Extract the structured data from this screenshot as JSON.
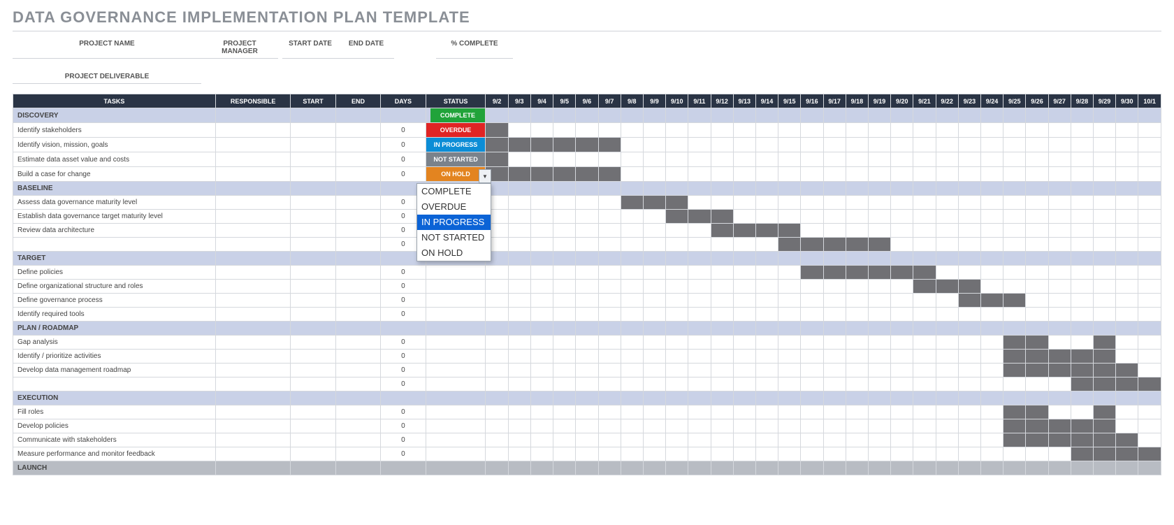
{
  "title": "DATA GOVERNANCE IMPLEMENTATION PLAN TEMPLATE",
  "meta": {
    "project_name": "PROJECT NAME",
    "project_manager": "PROJECT MANAGER",
    "start_date": "START DATE",
    "end_date": "END DATE",
    "pct_complete": "% COMPLETE",
    "project_deliverable": "PROJECT DELIVERABLE"
  },
  "columns": {
    "tasks": "TASKS",
    "responsible": "RESPONSIBLE",
    "start": "START",
    "end": "END",
    "days": "DAYS",
    "status": "STATUS"
  },
  "dates": [
    "9/2",
    "9/3",
    "9/4",
    "9/5",
    "9/6",
    "9/7",
    "9/8",
    "9/9",
    "9/10",
    "9/11",
    "9/12",
    "9/13",
    "9/14",
    "9/15",
    "9/16",
    "9/17",
    "9/18",
    "9/19",
    "9/20",
    "9/21",
    "9/22",
    "9/23",
    "9/24",
    "9/25",
    "9/26",
    "9/27",
    "9/28",
    "9/29",
    "9/30",
    "10/1"
  ],
  "status_labels": {
    "complete": "COMPLETE",
    "overdue": "OVERDUE",
    "in_progress": "IN PROGRESS",
    "not_started": "NOT STARTED",
    "on_hold": "ON HOLD"
  },
  "dropdown": {
    "options": [
      "COMPLETE",
      "OVERDUE",
      "IN PROGRESS",
      "NOT STARTED",
      "ON HOLD"
    ],
    "selected_index": 2
  },
  "rows": [
    {
      "type": "section",
      "label": "DISCOVERY",
      "status": "complete"
    },
    {
      "type": "task",
      "label": "Identify stakeholders",
      "days": "0",
      "status": "overdue",
      "bar": [
        0,
        1
      ]
    },
    {
      "type": "task",
      "label": "Identify vision, mission, goals",
      "days": "0",
      "status": "in_progress",
      "bar": [
        0,
        6
      ]
    },
    {
      "type": "task",
      "label": "Estimate data asset value and costs",
      "days": "0",
      "status": "not_started",
      "bar": [
        0,
        1
      ]
    },
    {
      "type": "task",
      "label": "Build a case for change",
      "days": "0",
      "status": "on_hold",
      "bar": [
        0,
        6
      ]
    },
    {
      "type": "section",
      "label": "BASELINE",
      "status": "dropdown"
    },
    {
      "type": "task",
      "label": "Assess data governance maturity level",
      "days": "0",
      "bar": [
        6,
        9
      ]
    },
    {
      "type": "task",
      "label": "Establish data governance target maturity level",
      "days": "0",
      "bar": [
        8,
        11
      ]
    },
    {
      "type": "task",
      "label": "Review data architecture",
      "days": "0",
      "bar": [
        10,
        14
      ]
    },
    {
      "type": "task",
      "label": "",
      "days": "0",
      "bar": [
        13,
        18
      ]
    },
    {
      "type": "section",
      "label": "TARGET"
    },
    {
      "type": "task",
      "label": "Define policies",
      "days": "0",
      "bar": [
        14,
        20
      ]
    },
    {
      "type": "task",
      "label": "Define organizational structure and roles",
      "days": "0",
      "bar": [
        19,
        22
      ]
    },
    {
      "type": "task",
      "label": "Define governance process",
      "days": "0",
      "bar": [
        21,
        24
      ]
    },
    {
      "type": "task",
      "label": "Identify required tools",
      "days": "0"
    },
    {
      "type": "section",
      "label": "PLAN / ROADMAP"
    },
    {
      "type": "task",
      "label": "Gap analysis",
      "days": "0",
      "bar": [
        [
          23,
          25
        ],
        [
          27,
          28
        ]
      ]
    },
    {
      "type": "task",
      "label": "Identify / prioritize activities",
      "days": "0",
      "bar": [
        23,
        28
      ]
    },
    {
      "type": "task",
      "label": "Develop data management roadmap",
      "days": "0",
      "bar": [
        23,
        29
      ]
    },
    {
      "type": "task",
      "label": "",
      "days": "0",
      "bar": [
        26,
        30
      ]
    },
    {
      "type": "section",
      "label": "EXECUTION"
    },
    {
      "type": "task",
      "label": "Fill roles",
      "days": "0",
      "bar": [
        [
          23,
          25
        ],
        [
          27,
          28
        ]
      ]
    },
    {
      "type": "task",
      "label": "Develop policies",
      "days": "0",
      "bar": [
        23,
        28
      ]
    },
    {
      "type": "task",
      "label": "Communicate with stakeholders",
      "days": "0",
      "bar": [
        23,
        29
      ]
    },
    {
      "type": "task",
      "label": "Measure performance and monitor feedback",
      "days": "0",
      "bar": [
        26,
        30
      ]
    },
    {
      "type": "launch",
      "label": "LAUNCH"
    }
  ]
}
